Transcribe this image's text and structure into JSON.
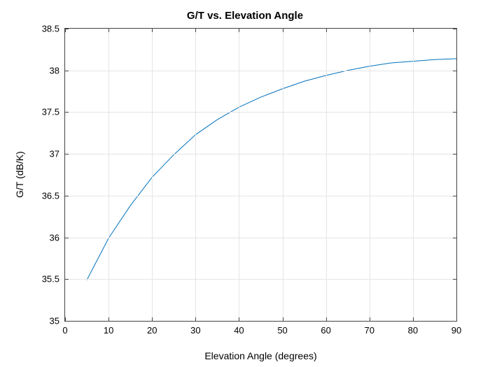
{
  "chart_data": {
    "type": "line",
    "title": "G/T vs. Elevation Angle",
    "xlabel": "Elevation Angle (degrees)",
    "ylabel": "G/T (dB/K)",
    "xlim": [
      0,
      90
    ],
    "ylim": [
      35,
      38.5
    ],
    "xticks": [
      0,
      10,
      20,
      30,
      40,
      50,
      60,
      70,
      80,
      90
    ],
    "yticks": [
      35,
      35.5,
      36,
      36.5,
      37,
      37.5,
      38,
      38.5
    ],
    "series": [
      {
        "name": "G/T",
        "color": "#0072BD",
        "x": [
          5,
          10,
          15,
          20,
          25,
          30,
          35,
          40,
          45,
          50,
          55,
          60,
          65,
          70,
          75,
          80,
          85,
          90
        ],
        "y": [
          35.49,
          35.99,
          36.38,
          36.72,
          36.99,
          37.23,
          37.41,
          37.56,
          37.68,
          37.78,
          37.87,
          37.94,
          38.0,
          38.05,
          38.09,
          38.11,
          38.13,
          38.14
        ]
      }
    ]
  }
}
